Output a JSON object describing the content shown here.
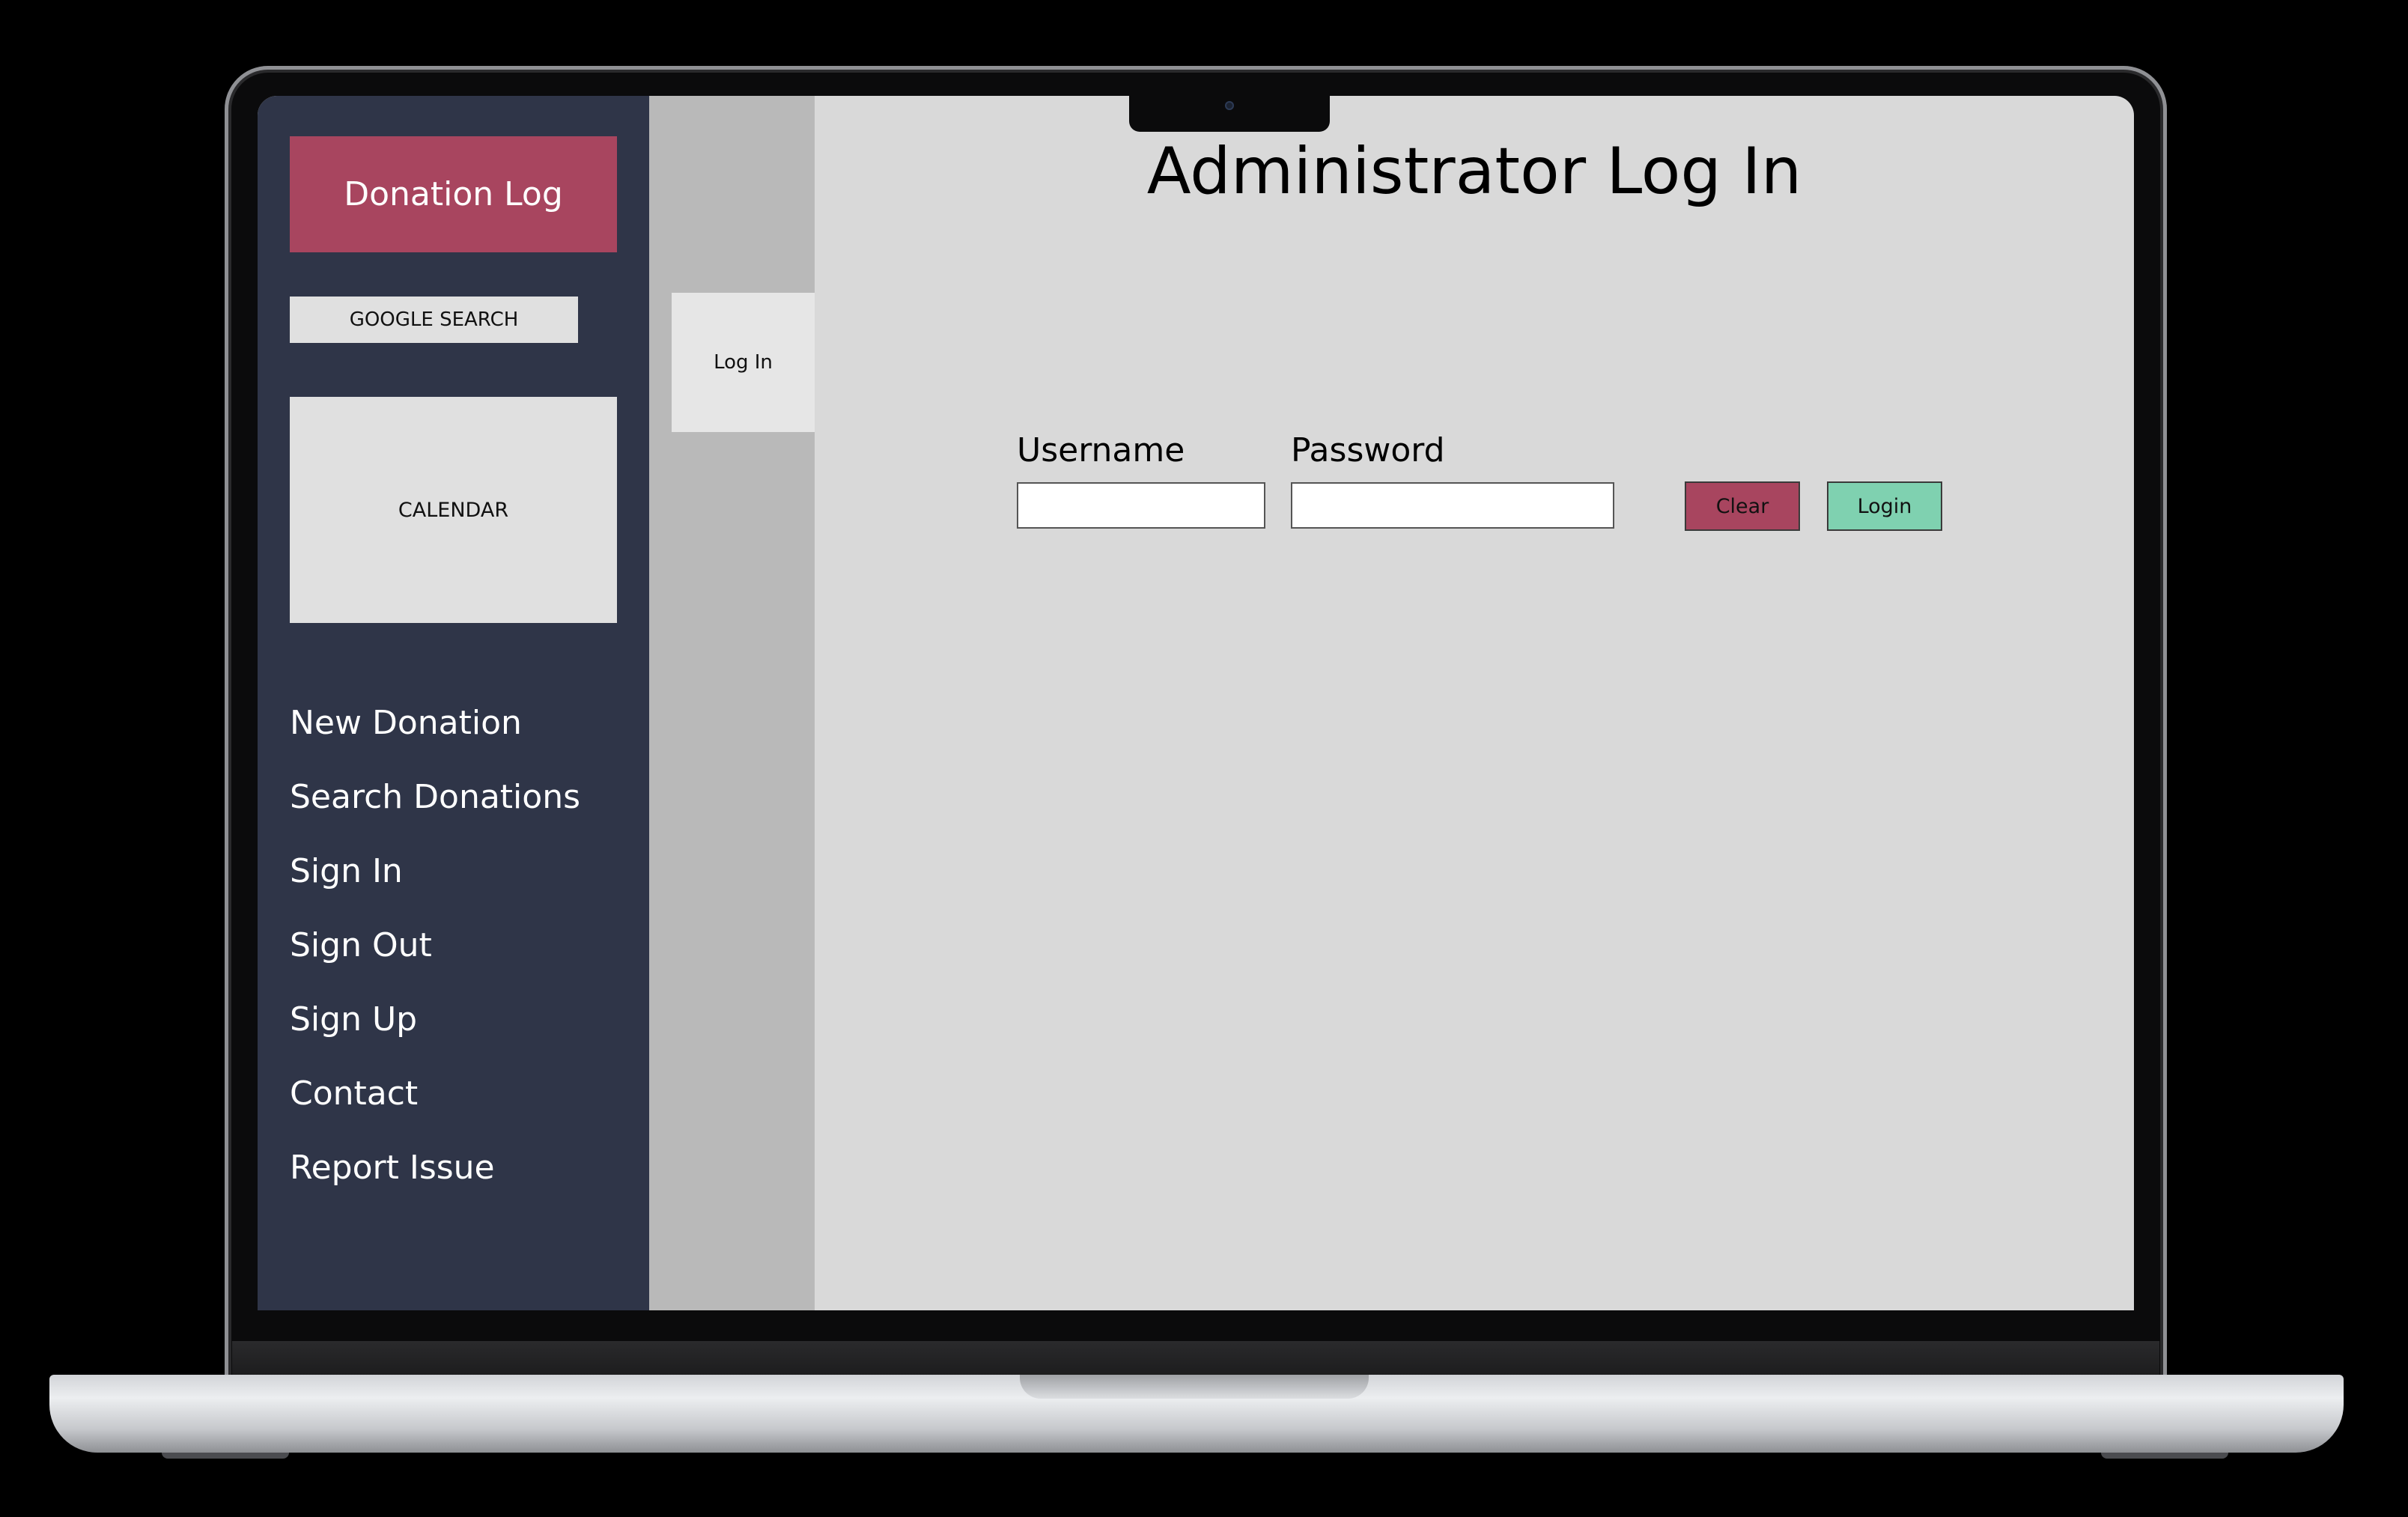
{
  "sidebar": {
    "brand_button": "Donation Log",
    "google_search": "GOOGLE SEARCH",
    "calendar": "CALENDAR",
    "nav": [
      "New Donation",
      "Search Donations",
      "Sign In",
      "Sign Out",
      "Sign Up",
      "Contact",
      "Report Issue"
    ]
  },
  "tabs": [
    {
      "label": "Log In"
    }
  ],
  "main": {
    "title": "Administrator Log In",
    "form": {
      "username_label": "Username",
      "username_value": "",
      "password_label": "Password",
      "password_value": "",
      "clear_button": "Clear",
      "login_button": "Login"
    }
  },
  "colors": {
    "sidebar_bg": "#2f3548",
    "brand_accent": "#a8455f",
    "clear_button": "#a8455f",
    "login_button": "#7fd1b0",
    "tab_strip": "#b9b9b9",
    "content_bg": "#d9d9d9"
  }
}
